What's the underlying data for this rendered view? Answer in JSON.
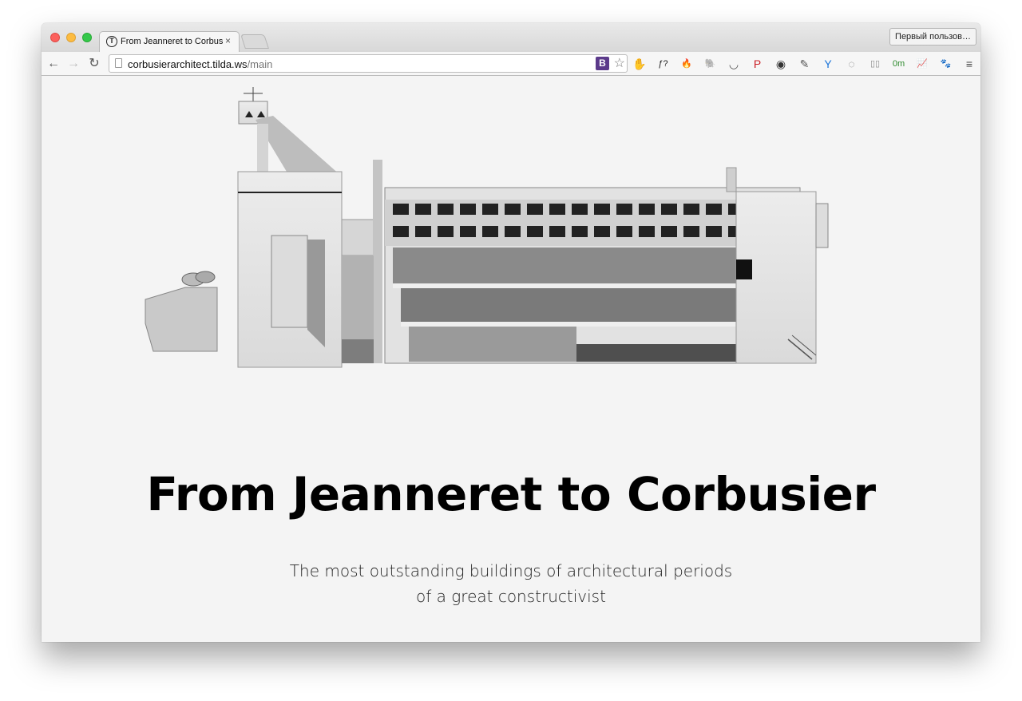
{
  "browser": {
    "tab_title": "From Jeanneret to Corbusier",
    "tab_close": "×",
    "favicon_letter": "T",
    "user_button": "Первый пользов…",
    "url_host": "corbusierarchitect.tilda.ws",
    "url_path": "/main",
    "nav": {
      "back": "←",
      "forward": "→",
      "reload": "↻"
    },
    "omnibox_icons": {
      "vk": "B",
      "star": "☆"
    },
    "extensions": [
      {
        "name": "adblock-icon",
        "glyph": "✋",
        "color": "#d0342c"
      },
      {
        "name": "font-finder-icon",
        "glyph": "ƒ?",
        "color": "#222222"
      },
      {
        "name": "fire-icon",
        "glyph": "🔥",
        "color": "#e8641c"
      },
      {
        "name": "evernote-icon",
        "glyph": "🐘",
        "color": "#555555"
      },
      {
        "name": "pocket-icon",
        "glyph": "◡",
        "color": "#555555"
      },
      {
        "name": "pinterest-icon",
        "glyph": "P",
        "color": "#cb2027"
      },
      {
        "name": "lens-icon",
        "glyph": "◉",
        "color": "#333333"
      },
      {
        "name": "eyedropper-icon",
        "glyph": "✎",
        "color": "#555555"
      },
      {
        "name": "y-icon",
        "glyph": "Y",
        "color": "#1b74d9"
      },
      {
        "name": "refresh-ring-icon",
        "glyph": "◌",
        "color": "#777777"
      },
      {
        "name": "reader-icon",
        "glyph": "▯▯",
        "color": "#8a8a8a"
      },
      {
        "name": "timer-icon",
        "glyph": "0m",
        "color": "#2e8b2e"
      },
      {
        "name": "stats-icon",
        "glyph": "📈",
        "color": "#e07a1c"
      },
      {
        "name": "paw-icon",
        "glyph": "🐾",
        "color": "#9a9a9a"
      },
      {
        "name": "menu-icon",
        "glyph": "≡",
        "color": "#444444"
      }
    ]
  },
  "page": {
    "headline": "From Jeanneret to Corbusier",
    "subtitle_line1": "The most outstanding buildings of architectural periods",
    "subtitle_line2": "of a great constructivist"
  }
}
